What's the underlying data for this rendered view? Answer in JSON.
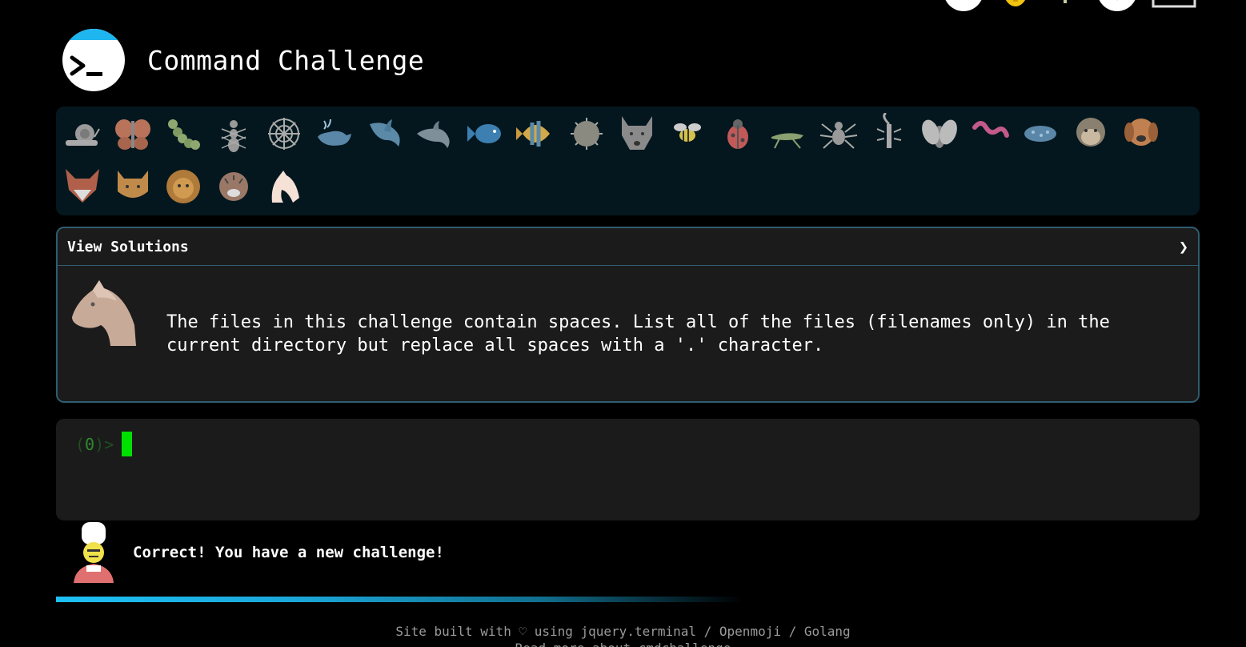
{
  "app": {
    "title": "Command Challenge",
    "logo_icon": "terminal-prompt-icon"
  },
  "top_icons": [
    "user-icon",
    "lightbulb-icon",
    "tree-icon",
    "badge-icon",
    "laptop-icon"
  ],
  "animals": [
    "snail",
    "butterfly",
    "caterpillar",
    "ant",
    "spider-web",
    "whale",
    "shark",
    "dolphin",
    "fish",
    "tropical-fish",
    "blowfish",
    "wolf",
    "bee",
    "ladybug",
    "cricket",
    "spider",
    "scorpion",
    "fly",
    "worm",
    "microbe",
    "monkey",
    "dog",
    "fox",
    "cat",
    "lion",
    "tiger",
    "horse"
  ],
  "solutions": {
    "label": "View Solutions",
    "chevron": "❯"
  },
  "challenge": {
    "avatar": "horse-icon",
    "text": "The files in this challenge contain spaces. List all of the files (filenames only) in the current directory but replace all spaces with a '.' character."
  },
  "terminal": {
    "prompt_open": "(",
    "prompt_count": "0",
    "prompt_close": ")>"
  },
  "status": {
    "avatar": "guard-icon",
    "text": "Correct! You have a new challenge!"
  },
  "footer": {
    "line1": "Site built with ♡ using jquery.terminal / Openmoji / Golang",
    "line2": "Read more about cmdchallenge"
  },
  "colors": {
    "accent": "#1fb6f0",
    "cursor": "#00e000",
    "panel_border": "#2e5c6e"
  }
}
